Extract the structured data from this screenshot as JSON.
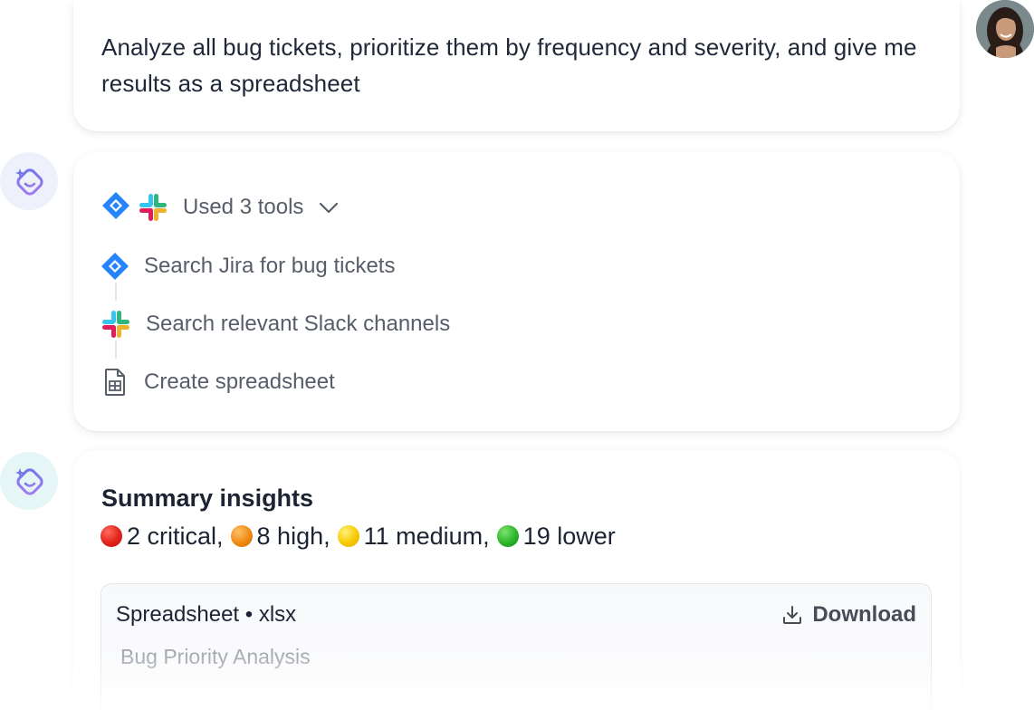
{
  "user_message": {
    "text": "Analyze all bug tickets, prioritize them by frequency and severity, and give me results as a spreadsheet",
    "avatar": "user-photo"
  },
  "tools_used": {
    "header_label": "Used 3 tools",
    "header_icons": [
      "jira-icon",
      "slack-icon"
    ],
    "expand_icon": "chevron-down-icon",
    "steps": [
      {
        "icon": "jira-icon",
        "label": "Search Jira for bug tickets"
      },
      {
        "icon": "slack-icon",
        "label": "Search relevant Slack channels"
      },
      {
        "icon": "spreadsheet-icon",
        "label": "Create spreadsheet"
      }
    ]
  },
  "summary": {
    "title": "Summary insights",
    "counts": [
      {
        "label": "2 critical,",
        "color": "#e2231a"
      },
      {
        "label": "8 high,",
        "color": "#f08a12"
      },
      {
        "label": "11 medium,",
        "color": "#f7c900"
      },
      {
        "label": "19 lower",
        "color": "#2bb52b"
      }
    ]
  },
  "attachment": {
    "type_label": "Spreadsheet • xlsx",
    "download_label": "Download",
    "file_name": "Bug Priority Analysis"
  },
  "colors": {
    "jira_blue": "#2684ff",
    "assistant_accent": "#7b6ff0",
    "text_primary": "#1c2434",
    "text_secondary": "#575d69"
  }
}
